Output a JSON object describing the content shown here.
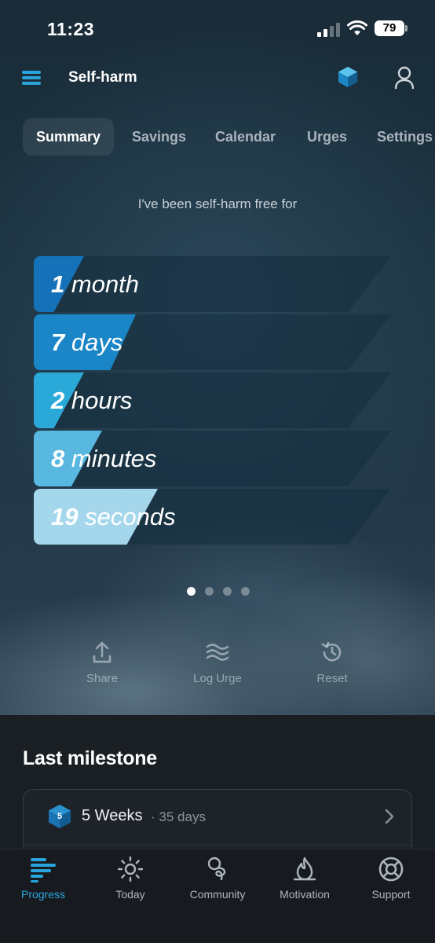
{
  "status_bar": {
    "time": "11:23",
    "battery": "79"
  },
  "header": {
    "title": "Self-harm"
  },
  "tabs": [
    {
      "label": "Summary",
      "active": true
    },
    {
      "label": "Savings",
      "active": false
    },
    {
      "label": "Calendar",
      "active": false
    },
    {
      "label": "Urges",
      "active": false
    },
    {
      "label": "Settings",
      "active": false
    }
  ],
  "summary": {
    "intro": "I've been self-harm free for",
    "counters": [
      {
        "value": "1",
        "unit": "month",
        "color": "#1572b8"
      },
      {
        "value": "7",
        "unit": "days",
        "color": "#1a86c7"
      },
      {
        "value": "2",
        "unit": "hours",
        "color": "#2aa8d8"
      },
      {
        "value": "8",
        "unit": "minutes",
        "color": "#58b8df"
      },
      {
        "value": "19",
        "unit": "seconds",
        "color": "#a5d7ec"
      }
    ],
    "pager": {
      "pages": 4,
      "current": 1
    }
  },
  "actions": [
    {
      "label": "Share",
      "icon": "share-icon"
    },
    {
      "label": "Log Urge",
      "icon": "waves-icon"
    },
    {
      "label": "Reset",
      "icon": "history-icon"
    }
  ],
  "last_milestone": {
    "title": "Last milestone",
    "badge": "5",
    "name": "5 Weeks",
    "separator": "·",
    "days": "35 days"
  },
  "bottom_nav": [
    {
      "label": "Progress",
      "icon": "progress-bars-icon",
      "active": true
    },
    {
      "label": "Today",
      "icon": "sun-icon",
      "active": false
    },
    {
      "label": "Community",
      "icon": "community-icon",
      "active": false
    },
    {
      "label": "Motivation",
      "icon": "flame-icon",
      "active": false
    },
    {
      "label": "Support",
      "icon": "lifebuoy-icon",
      "active": false
    }
  ],
  "colors": {
    "accent": "#29a4dc",
    "background": "#14191e"
  }
}
